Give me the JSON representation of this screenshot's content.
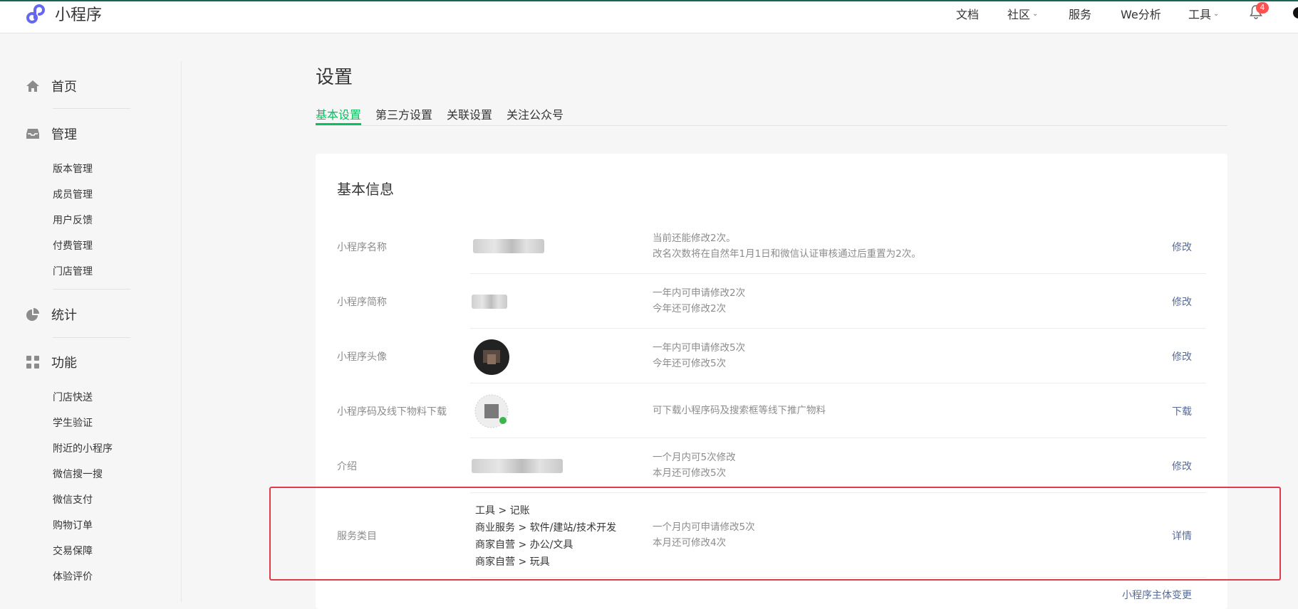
{
  "header": {
    "logo_text": "小程序",
    "nav": [
      {
        "label": "文档",
        "dropdown": false
      },
      {
        "label": "社区",
        "dropdown": true
      },
      {
        "label": "服务",
        "dropdown": false
      },
      {
        "label": "We分析",
        "dropdown": false
      },
      {
        "label": "工具",
        "dropdown": true
      }
    ],
    "notification_count": "4"
  },
  "sidebar": {
    "home": "首页",
    "manage": {
      "label": "管理",
      "items": [
        "版本管理",
        "成员管理",
        "用户反馈",
        "付费管理",
        "门店管理"
      ]
    },
    "stats": "统计",
    "features": {
      "label": "功能",
      "items": [
        "门店快送",
        "学生验证",
        "附近的小程序",
        "微信搜一搜",
        "微信支付",
        "购物订单",
        "交易保障",
        "体验评价"
      ]
    }
  },
  "main": {
    "title": "设置",
    "tabs": [
      "基本设置",
      "第三方设置",
      "关联设置",
      "关注公众号"
    ],
    "active_tab": "基本设置",
    "section_title": "基本信息",
    "rows": [
      {
        "label": "小程序名称",
        "desc": [
          "当前还能修改2次。",
          "改名次数将在自然年1月1日和微信认证审核通过后重置为2次。"
        ],
        "action": "修改"
      },
      {
        "label": "小程序简称",
        "desc": [
          "一年内可申请修改2次",
          "今年还可修改2次"
        ],
        "action": "修改"
      },
      {
        "label": "小程序头像",
        "desc": [
          "一年内可申请修改5次",
          "今年还可修改5次"
        ],
        "action": "修改"
      },
      {
        "label": "小程序码及线下物料下载",
        "desc": [
          "可下载小程序码及搜索框等线下推广物料"
        ],
        "action": "下载"
      },
      {
        "label": "介绍",
        "desc": [
          "一个月内可5次修改",
          "本月还可修改5次"
        ],
        "action": "修改"
      },
      {
        "label": "服务类目",
        "desc": [
          "一个月内可申请修改5次",
          "本月还可修改4次"
        ],
        "action": "详情"
      }
    ],
    "service_categories": [
      "工具 > 记账",
      "商业服务 > 软件/建站/技术开发",
      "商家自营 > 办公/文具",
      "商家自营 > 玩具"
    ],
    "footer_link": "小程序主体变更"
  },
  "colors": {
    "accent": "#07c160",
    "link": "#576b95",
    "highlight_border": "#e03b4a",
    "badge": "#fa5151"
  }
}
